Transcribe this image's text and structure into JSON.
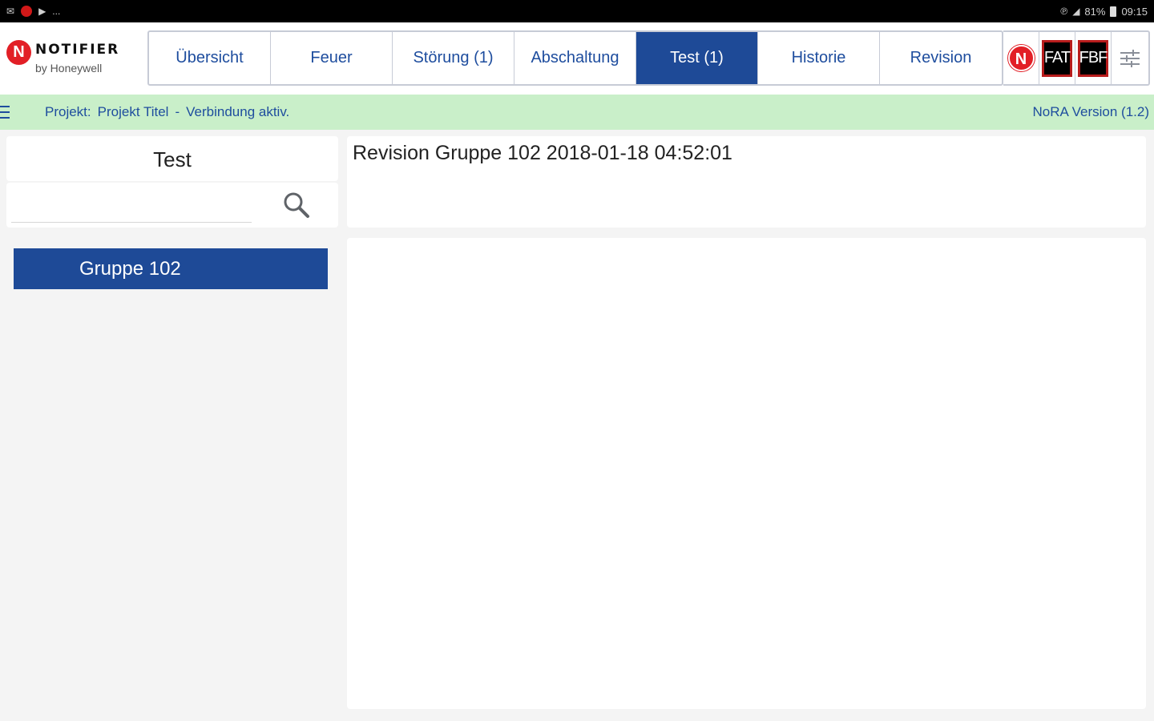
{
  "statusbar": {
    "left_more": "...",
    "battery": "81%",
    "time": "09:15"
  },
  "logo": {
    "mark": "N",
    "word": "NOTIFIER",
    "sub": "by Honeywell"
  },
  "tabs": [
    {
      "label": "Übersicht",
      "active": false
    },
    {
      "label": "Feuer",
      "active": false
    },
    {
      "label": "Störung (1)",
      "active": false
    },
    {
      "label": "Abschaltung",
      "active": false
    },
    {
      "label": "Test (1)",
      "active": true
    },
    {
      "label": "Historie",
      "active": false
    },
    {
      "label": "Revision",
      "active": false
    }
  ],
  "tools": {
    "n_mark": "N",
    "fat": "FAT",
    "fbf": "FBF"
  },
  "project_bar": {
    "project_label": "Projekt:",
    "project_name": "Projekt Titel",
    "separator": "-",
    "connection": "Verbindung aktiv.",
    "version": "NoRA Version (1.2)"
  },
  "left_panel": {
    "title": "Test",
    "search_value": "",
    "groups": [
      "Gruppe 102"
    ]
  },
  "detail": {
    "text": "Revision Gruppe 102 2018-01-18 04:52:01"
  },
  "colors": {
    "primary_blue": "#1e4a97",
    "project_bar_bg": "#c9efc9",
    "brand_red": "#e21f26"
  }
}
